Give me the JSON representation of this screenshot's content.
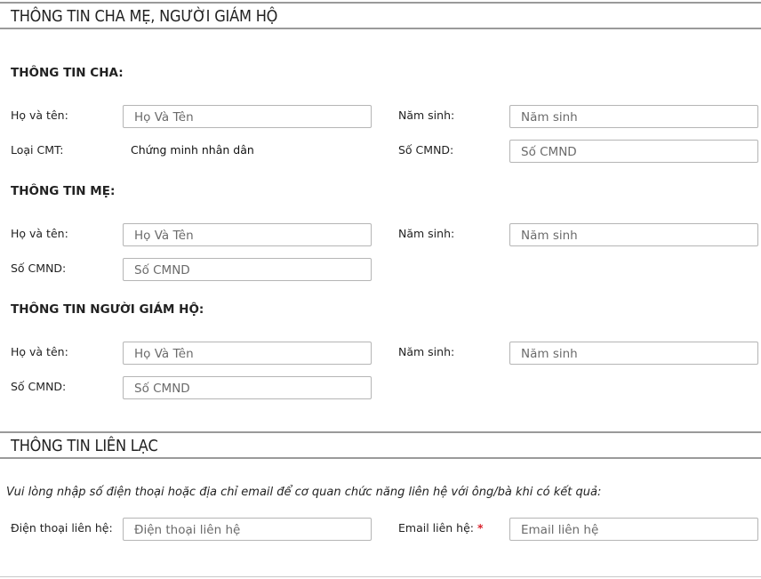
{
  "parent_section": {
    "title": "THÔNG TIN CHA MẸ, NGƯỜI GIÁM HỘ",
    "father": {
      "heading": "THÔNG TIN CHA:",
      "name_label": "Họ và tên:",
      "name_placeholder": "Họ Và Tên",
      "birth_year_label": "Năm sinh:",
      "birth_year_placeholder": "Năm sinh",
      "id_type_label": "Loại CMT:",
      "id_type_value": "Chứng minh nhân dân",
      "id_number_label": "Số CMND:",
      "id_number_placeholder": "Số CMND"
    },
    "mother": {
      "heading": "THÔNG TIN MẸ:",
      "name_label": "Họ và tên:",
      "name_placeholder": "Họ Và Tên",
      "birth_year_label": "Năm sinh:",
      "birth_year_placeholder": "Năm sinh",
      "id_number_label": "Số CMND:",
      "id_number_placeholder": "Số CMND"
    },
    "guardian": {
      "heading": "THÔNG TIN NGƯỜI GIÁM HỘ:",
      "name_label": "Họ và tên:",
      "name_placeholder": "Họ Và Tên",
      "birth_year_label": "Năm sinh:",
      "birth_year_placeholder": "Năm sinh",
      "id_number_label": "Số CMND:",
      "id_number_placeholder": "Số CMND"
    }
  },
  "contact_section": {
    "title": "THÔNG TIN LIÊN LẠC",
    "note": "Vui lòng nhập số điện thoại hoặc địa chỉ email để cơ quan chức năng liên hệ với ông/bà khi có kết quả:",
    "phone_label": "Điện thoại liên hệ:",
    "phone_placeholder": "Điện thoại liên hệ",
    "email_label": "Email liên hệ:",
    "email_required_mark": "*",
    "email_placeholder": "Email liên hệ"
  },
  "colors": {
    "border": "#9a9a9a",
    "required": "#d9232d"
  }
}
